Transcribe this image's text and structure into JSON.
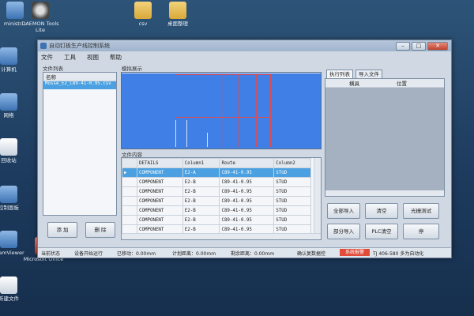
{
  "desktop": {
    "icons": [
      {
        "label": "ministr...",
        "glyph": "app-icon"
      },
      {
        "label": "DAEMON Tools Lite",
        "glyph": "daemon-icon"
      },
      {
        "label": "csv",
        "glyph": "folder-icon"
      },
      {
        "label": "桌面整理",
        "glyph": "folder-icon"
      },
      {
        "label": "计算机",
        "glyph": "computer-icon"
      },
      {
        "label": "网络",
        "glyph": "network-icon"
      },
      {
        "label": "回收站",
        "glyph": "recycle-bin-icon"
      },
      {
        "label": "控制面板",
        "glyph": "control-panel-icon"
      },
      {
        "label": "TeamViewer",
        "glyph": "app-icon"
      },
      {
        "label": "Microsoft Office",
        "glyph": "app-icon"
      },
      {
        "label": "新建文件",
        "glyph": "document-icon"
      }
    ]
  },
  "window": {
    "title": "自动钉板生产线控制系统",
    "menu": [
      "文件",
      "工具",
      "视图",
      "帮助"
    ],
    "controls": {
      "minimize": "–",
      "maximize": "□",
      "close": "✕"
    }
  },
  "file_list": {
    "label": "文件列表",
    "header": "名称",
    "items": [
      "Mosse_E2_C89-41-0.95.csv"
    ],
    "add_button": "添 加",
    "delete_button": "删 除"
  },
  "simulation": {
    "label": "模拟展示"
  },
  "file_content": {
    "label": "文件内容",
    "columns": [
      "DETAILS",
      "Column1",
      "Route",
      "Column2"
    ],
    "rows": [
      [
        "COMPONENT",
        "E2-A",
        "C89-41-0.95",
        "STUD"
      ],
      [
        "COMPONENT",
        "E2-B",
        "C89-41-0.95",
        "STUD"
      ],
      [
        "COMPONENT",
        "E2-B",
        "C89-41-0.95",
        "STUD"
      ],
      [
        "COMPONENT",
        "E2-B",
        "C89-41-0.95",
        "STUD"
      ],
      [
        "COMPONENT",
        "E2-B",
        "C89-41-0.95",
        "STUD"
      ],
      [
        "COMPONENT",
        "E2-B",
        "C89-41-0.95",
        "STUD"
      ],
      [
        "COMPONENT",
        "E2-B",
        "C89-41-0.95",
        "STUD"
      ]
    ]
  },
  "exec_panel": {
    "tabs": [
      "执行列表",
      "导入文件"
    ],
    "columns": [
      "横具",
      "位置"
    ],
    "buttons": {
      "import_all": "全部导入",
      "clear": "清空",
      "wire_test": "光栅测试",
      "partial_import": "部分导入",
      "plc_clear": "PLC清空",
      "stop": "停"
    }
  },
  "status": {
    "state": "当前状态",
    "device": "设备开始运行",
    "moved": "已移动：0.00mm",
    "planned": "计划距离：0.00mm",
    "remaining": "剩余距离：0.00mm",
    "confirm": "确认复数据控",
    "alarm": "系统报警",
    "phone": "TJ 406-580 多为自动化"
  },
  "colors": {
    "selection": "#4aa0e0",
    "canvas": "#3f7fe6",
    "cut_line": "#e84a4a",
    "alarm": "#e24a3a"
  }
}
